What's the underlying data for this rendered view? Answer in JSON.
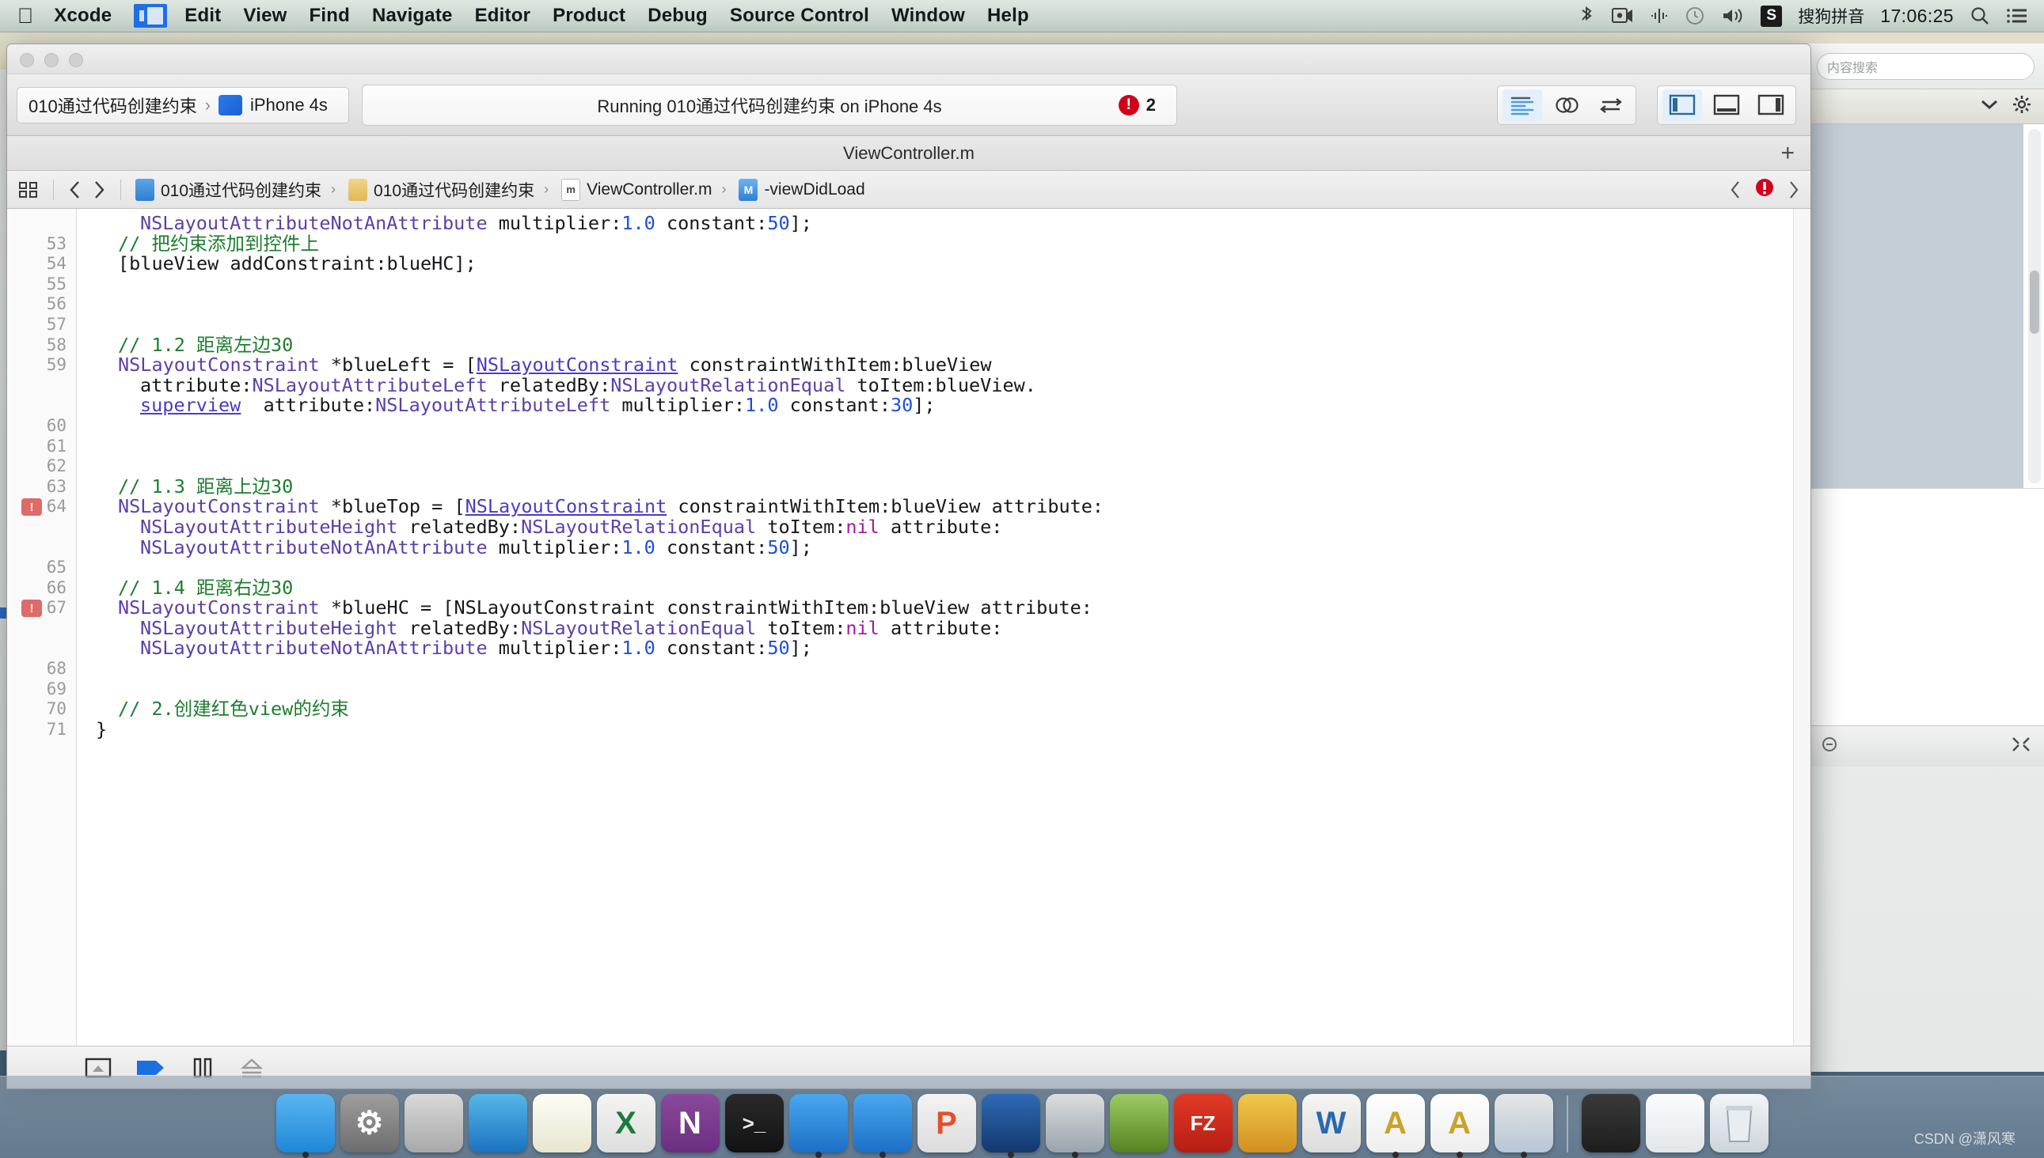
{
  "menubar": {
    "apple_icon": "apple-icon",
    "app_name": "Xcode",
    "app_icon": "xcode-app-icon",
    "items": [
      "Edit",
      "View",
      "Find",
      "Navigate",
      "Editor",
      "Product",
      "Debug",
      "Source Control",
      "Window",
      "Help"
    ],
    "right_icons": [
      "bluetooth-icon",
      "screen-record-icon",
      "airdrop-icon",
      "time-machine-icon",
      "volume-icon"
    ],
    "input_method_badge": "S",
    "input_method_label": "搜狗拼音",
    "clock": "17:06:25",
    "search_icon": "search-icon",
    "control-center_icon": "list-menu-icon"
  },
  "xcode": {
    "window_title": "ViewController.m",
    "traffic_lights": [
      "close-button",
      "minimize-button",
      "zoom-button"
    ],
    "toolbar": {
      "scheme_name": "010通过代码创建约束",
      "scheme_separator": "›",
      "destination": "iPhone 4s",
      "status_text": "Running 010通过代码创建约束 on iPhone 4s",
      "error_count": "2",
      "error_glyph": "!",
      "editor_buttons": [
        "standard-editor-icon",
        "assistant-editor-icon",
        "version-editor-icon"
      ],
      "panel_buttons": [
        "navigator-toggle-icon",
        "debug-area-toggle-icon",
        "utilities-toggle-icon"
      ]
    },
    "editor_title": "ViewController.m",
    "add_editor_label": "+",
    "jumpbar": {
      "related_items_icon": "related-items-icon",
      "back_icon": "chevron-left-icon",
      "forward_icon": "chevron-right-icon",
      "crumbs": [
        {
          "icon": "project-icon",
          "label": "010通过代码创建约束"
        },
        {
          "icon": "folder-icon",
          "label": "010通过代码创建约束"
        },
        {
          "icon": "m-file-icon",
          "label": "ViewController.m"
        },
        {
          "icon": "method-icon",
          "label": "-viewDidLoad"
        }
      ],
      "prev_issue_icon": "chevron-left-icon",
      "issue_icon": "error-icon",
      "next_issue_icon": "chevron-right-icon"
    },
    "debugbar": {
      "buttons": [
        "hide-debug-area-icon",
        "continue-icon",
        "pause-icon",
        "step-over-icon"
      ]
    }
  },
  "code": {
    "lines": [
      {
        "num": "",
        "err": false,
        "indent": 2,
        "tokens": [
          {
            "t": "NSLayoutAttributeNotAnAttribute ",
            "c": "c-type"
          },
          {
            "t": "multiplier:",
            "c": "c-plain"
          },
          {
            "t": "1.0",
            "c": "c-num"
          },
          {
            "t": " constant:",
            "c": "c-plain"
          },
          {
            "t": "50",
            "c": "c-num"
          },
          {
            "t": "];",
            "c": "c-plain"
          }
        ]
      },
      {
        "num": "53",
        "err": false,
        "indent": 1,
        "tokens": [
          {
            "t": "// 把约束添加到控件上",
            "c": "c-com"
          }
        ]
      },
      {
        "num": "54",
        "err": false,
        "indent": 1,
        "tokens": [
          {
            "t": "[blueView addConstraint:blueHC];",
            "c": "c-plain"
          }
        ]
      },
      {
        "num": "55",
        "err": false,
        "indent": 0,
        "tokens": []
      },
      {
        "num": "56",
        "err": false,
        "indent": 0,
        "tokens": []
      },
      {
        "num": "57",
        "err": false,
        "indent": 0,
        "tokens": []
      },
      {
        "num": "58",
        "err": false,
        "indent": 1,
        "tokens": [
          {
            "t": "// 1.2 距离左边30",
            "c": "c-com"
          }
        ]
      },
      {
        "num": "59",
        "err": false,
        "indent": 1,
        "tokens": [
          {
            "t": "NSLayoutConstraint",
            "c": "c-type"
          },
          {
            "t": " *blueLeft = [",
            "c": "c-plain"
          },
          {
            "t": "NSLayoutConstraint",
            "c": "c-link"
          },
          {
            "t": " constraintWithItem:blueView",
            "c": "c-plain"
          }
        ]
      },
      {
        "num": "",
        "err": false,
        "indent": 2,
        "tokens": [
          {
            "t": "attribute:",
            "c": "c-plain"
          },
          {
            "t": "NSLayoutAttributeLeft",
            "c": "c-type"
          },
          {
            "t": " relatedBy:",
            "c": "c-plain"
          },
          {
            "t": "NSLayoutRelationEqual",
            "c": "c-type"
          },
          {
            "t": " toItem:blueView.",
            "c": "c-plain"
          }
        ]
      },
      {
        "num": "",
        "err": false,
        "indent": 2,
        "tokens": [
          {
            "t": "superview",
            "c": "c-link"
          },
          {
            "t": "  attribute:",
            "c": "c-plain"
          },
          {
            "t": "NSLayoutAttributeLeft",
            "c": "c-type"
          },
          {
            "t": " multiplier:",
            "c": "c-plain"
          },
          {
            "t": "1.0",
            "c": "c-num"
          },
          {
            "t": " constant:",
            "c": "c-plain"
          },
          {
            "t": "30",
            "c": "c-num"
          },
          {
            "t": "];",
            "c": "c-plain"
          }
        ]
      },
      {
        "num": "60",
        "err": false,
        "indent": 0,
        "tokens": []
      },
      {
        "num": "61",
        "err": false,
        "indent": 0,
        "tokens": []
      },
      {
        "num": "62",
        "err": false,
        "indent": 0,
        "tokens": []
      },
      {
        "num": "63",
        "err": false,
        "indent": 1,
        "tokens": [
          {
            "t": "// 1.3 距离上边30",
            "c": "c-com"
          }
        ]
      },
      {
        "num": "64",
        "err": true,
        "indent": 1,
        "tokens": [
          {
            "t": "NSLayoutConstraint",
            "c": "c-type"
          },
          {
            "t": " *blueTop = [",
            "c": "c-plain"
          },
          {
            "t": "NSLayoutConstraint",
            "c": "c-link"
          },
          {
            "t": " constraintWithItem:blueView attribute:",
            "c": "c-plain"
          }
        ]
      },
      {
        "num": "",
        "err": false,
        "indent": 2,
        "tokens": [
          {
            "t": "NSLayoutAttributeHeight",
            "c": "c-type"
          },
          {
            "t": " relatedBy:",
            "c": "c-plain"
          },
          {
            "t": "NSLayoutRelationEqual",
            "c": "c-type"
          },
          {
            "t": " toItem:",
            "c": "c-plain"
          },
          {
            "t": "nil",
            "c": "c-nil"
          },
          {
            "t": " attribute:",
            "c": "c-plain"
          }
        ]
      },
      {
        "num": "",
        "err": false,
        "indent": 2,
        "tokens": [
          {
            "t": "NSLayoutAttributeNotAnAttribute",
            "c": "c-type"
          },
          {
            "t": " multiplier:",
            "c": "c-plain"
          },
          {
            "t": "1.0",
            "c": "c-num"
          },
          {
            "t": " constant:",
            "c": "c-plain"
          },
          {
            "t": "50",
            "c": "c-num"
          },
          {
            "t": "];",
            "c": "c-plain"
          }
        ]
      },
      {
        "num": "65",
        "err": false,
        "indent": 0,
        "tokens": []
      },
      {
        "num": "66",
        "err": false,
        "indent": 1,
        "tokens": [
          {
            "t": "// 1.4 距离右边30",
            "c": "c-com"
          }
        ]
      },
      {
        "num": "67",
        "err": true,
        "indent": 1,
        "tokens": [
          {
            "t": "NSLayoutConstraint",
            "c": "c-type"
          },
          {
            "t": " *blueHC = [",
            "c": "c-plain"
          },
          {
            "t": "NSLayoutConstraint",
            "c": "c-plain"
          },
          {
            "t": " constraintWithItem:blueView attribute:",
            "c": "c-plain"
          }
        ]
      },
      {
        "num": "",
        "err": false,
        "indent": 2,
        "tokens": [
          {
            "t": "NSLayoutAttributeHeight",
            "c": "c-type"
          },
          {
            "t": " relatedBy:",
            "c": "c-plain"
          },
          {
            "t": "NSLayoutRelationEqual",
            "c": "c-type"
          },
          {
            "t": " toItem:",
            "c": "c-plain"
          },
          {
            "t": "nil",
            "c": "c-nil"
          },
          {
            "t": " attribute:",
            "c": "c-plain"
          }
        ]
      },
      {
        "num": "",
        "err": false,
        "indent": 2,
        "tokens": [
          {
            "t": "NSLayoutAttributeNotAnAttribute",
            "c": "c-type"
          },
          {
            "t": " multiplier:",
            "c": "c-plain"
          },
          {
            "t": "1.0",
            "c": "c-num"
          },
          {
            "t": " constant:",
            "c": "c-plain"
          },
          {
            "t": "50",
            "c": "c-num"
          },
          {
            "t": "];",
            "c": "c-plain"
          }
        ]
      },
      {
        "num": "68",
        "err": false,
        "indent": 0,
        "tokens": []
      },
      {
        "num": "69",
        "err": false,
        "indent": 0,
        "tokens": []
      },
      {
        "num": "70",
        "err": false,
        "indent": 1,
        "tokens": [
          {
            "t": "// 2.创建红色view的约束",
            "c": "c-com"
          }
        ]
      },
      {
        "num": "71",
        "err": false,
        "indent": 0,
        "tokens": [
          {
            "t": "}",
            "c": "c-plain"
          }
        ]
      }
    ]
  },
  "background_window": {
    "search_placeholder": "内容搜索",
    "chevron_icon": "chevron-down-icon",
    "gear_icon": "gear-icon",
    "footer_left_icon": "minus-icon",
    "footer_right_icon": "expand-icon"
  },
  "dock": {
    "items": [
      {
        "name": "finder",
        "glyph": "",
        "bg": "linear-gradient(180deg,#5ab5f0,#1f87d8)",
        "running": true
      },
      {
        "name": "system-preferences",
        "glyph": "⚙",
        "bg": "linear-gradient(180deg,#9e9e9e,#6d6d6d)",
        "running": false
      },
      {
        "name": "launchpad",
        "glyph": "",
        "bg": "linear-gradient(180deg,#d9d9d9,#a8a8a8)",
        "running": false
      },
      {
        "name": "safari",
        "glyph": "",
        "bg": "linear-gradient(180deg,#56b8e8,#1b72c0)",
        "running": false
      },
      {
        "name": "notes",
        "glyph": "",
        "bg": "linear-gradient(180deg,#fdfdf5,#e8e5d0)",
        "running": false
      },
      {
        "name": "microsoft-excel",
        "glyph": "X",
        "bg": "linear-gradient(180deg,#f4f4f2,#dedede)",
        "running": false
      },
      {
        "name": "microsoft-onenote",
        "glyph": "N",
        "bg": "linear-gradient(180deg,#8a4a9c,#6b2e80)",
        "running": false
      },
      {
        "name": "terminal",
        "glyph": ">_",
        "bg": "linear-gradient(180deg,#2a2a2a,#121212)",
        "running": false
      },
      {
        "name": "xcode",
        "glyph": "",
        "bg": "linear-gradient(180deg,#4aa8ef,#1b6fc7)",
        "running": true
      },
      {
        "name": "xcode-beta",
        "glyph": "",
        "bg": "linear-gradient(180deg,#4aa8ef,#1b6fc7)",
        "running": true
      },
      {
        "name": "pdf-reader",
        "glyph": "P",
        "bg": "linear-gradient(180deg,#f3f3f3,#dcdcdc)",
        "running": false
      },
      {
        "name": "snipping-tool",
        "glyph": "",
        "bg": "linear-gradient(180deg,#2e6bb5,#12386e)",
        "running": true
      },
      {
        "name": "video-converter",
        "glyph": "",
        "bg": "linear-gradient(180deg,#dddddd,#9aa4ae)",
        "running": true
      },
      {
        "name": "photo-viewer",
        "glyph": "",
        "bg": "linear-gradient(180deg,#9dcb66,#56821f)",
        "running": false
      },
      {
        "name": "filezilla",
        "glyph": "FZ",
        "bg": "linear-gradient(180deg,#e23b27,#b51d12)",
        "running": false
      },
      {
        "name": "paint",
        "glyph": "",
        "bg": "linear-gradient(180deg,#f0c94a,#d28f1f)",
        "running": false
      },
      {
        "name": "microsoft-word",
        "glyph": "W",
        "bg": "linear-gradient(180deg,#f5f5f3,#dcdcdc)",
        "running": false
      },
      {
        "name": "font-book",
        "glyph": "A",
        "bg": "linear-gradient(180deg,#fefefe,#eeeeee)",
        "running": true
      },
      {
        "name": "font-book-2",
        "glyph": "A",
        "bg": "linear-gradient(180deg,#fefefe,#eeeeee)",
        "running": true
      },
      {
        "name": "preview",
        "glyph": "",
        "bg": "linear-gradient(180deg,#e6e6e6,#b7c6d6)",
        "running": true
      }
    ],
    "stack_items": [
      {
        "name": "downloads-stack",
        "bg": "linear-gradient(180deg,#3a3a3a,#1d1d1d)"
      },
      {
        "name": "documents-stack",
        "bg": "linear-gradient(180deg,#fcfcfc,#e2e6ea)"
      }
    ],
    "trash": {
      "name": "trash",
      "glyph": ""
    }
  },
  "watermark": "CSDN @潇风寒"
}
